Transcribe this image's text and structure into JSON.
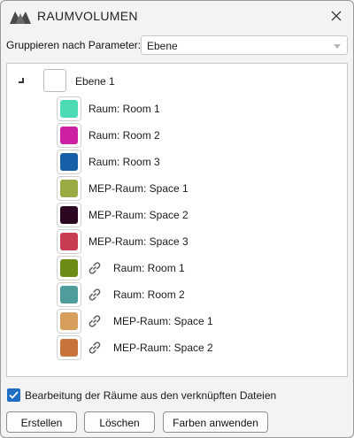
{
  "window": {
    "title": "RAUMVOLUMEN"
  },
  "grouping": {
    "label": "Gruppieren nach Parameter:",
    "selected": "Ebene"
  },
  "tree": {
    "root": {
      "label": "Ebene 1"
    },
    "items": [
      {
        "label": "Raum: Room 1",
        "color": "#4ddbb6",
        "linked": false
      },
      {
        "label": "Raum: Room 2",
        "color": "#cc1fa4",
        "linked": false
      },
      {
        "label": "Raum: Room 3",
        "color": "#1560a6",
        "linked": false
      },
      {
        "label": "MEP-Raum: Space 1",
        "color": "#9aab46",
        "linked": false
      },
      {
        "label": "MEP-Raum: Space 2",
        "color": "#2a0620",
        "linked": false
      },
      {
        "label": "MEP-Raum: Space 3",
        "color": "#c73c52",
        "linked": false
      },
      {
        "label": "Raum: Room 1",
        "color": "#6a8c14",
        "linked": true
      },
      {
        "label": "Raum: Room 2",
        "color": "#4e9c9c",
        "linked": true
      },
      {
        "label": "MEP-Raum: Space 1",
        "color": "#d79e5c",
        "linked": true
      },
      {
        "label": "MEP-Raum: Space 2",
        "color": "#c7743a",
        "linked": true
      }
    ]
  },
  "options": {
    "edit_linked_label": "Bearbeitung der Räume aus den verknüpften Dateien",
    "edit_linked_checked": true
  },
  "buttons": {
    "create": "Erstellen",
    "delete": "Löschen",
    "apply_colors": "Farben anwenden"
  },
  "icons": {
    "logo": "app-logo-icon",
    "close": "close-icon",
    "link": "link-icon",
    "expander": "expander-icon",
    "check": "checkmark-icon"
  }
}
